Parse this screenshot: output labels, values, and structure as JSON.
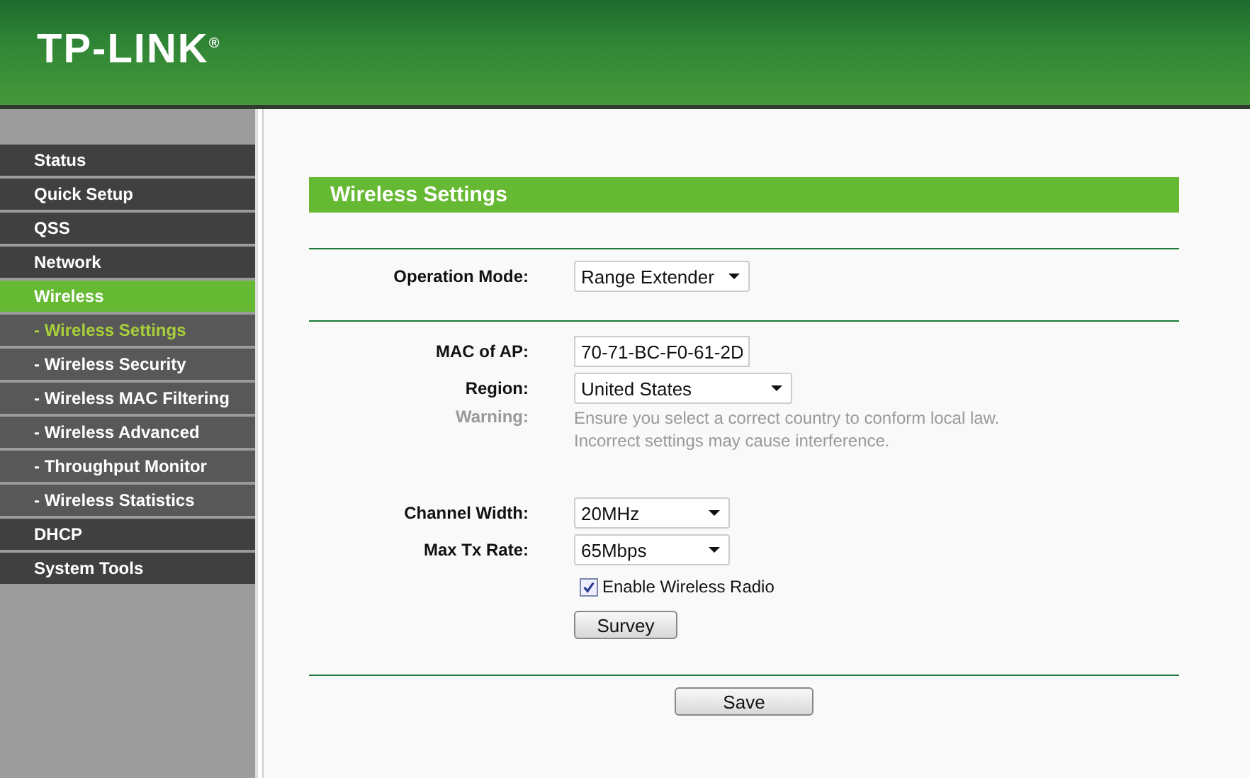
{
  "header": {
    "logo": "TP-LINK$^{®}$"
  },
  "sidebar": {
    "items": [
      {
        "label": "Status",
        "kind": "main",
        "selected": false
      },
      {
        "label": "Quick Setup",
        "kind": "main",
        "selected": false
      },
      {
        "label": "QSS",
        "kind": "main",
        "selected": false
      },
      {
        "label": "Network",
        "kind": "main",
        "selected": false
      },
      {
        "label": "Wireless",
        "kind": "main",
        "selected": true
      },
      {
        "label": "- Wireless Settings",
        "kind": "sub",
        "selected": true
      },
      {
        "label": "- Wireless Security",
        "kind": "sub",
        "selected": false
      },
      {
        "label": "- Wireless MAC Filtering",
        "kind": "sub",
        "selected": false
      },
      {
        "label": "- Wireless Advanced",
        "kind": "sub",
        "selected": false
      },
      {
        "label": "- Throughput Monitor",
        "kind": "sub",
        "selected": false
      },
      {
        "label": "- Wireless Statistics",
        "kind": "sub",
        "selected": false
      },
      {
        "label": "DHCP",
        "kind": "main",
        "selected": false
      },
      {
        "label": "System Tools",
        "kind": "main",
        "selected": false
      }
    ]
  },
  "panel": {
    "title": "Wireless Settings",
    "operation_mode": {
      "label": "Operation Mode:",
      "value": "Range Extender"
    },
    "mac_of_ap": {
      "label": "MAC of AP:",
      "value": "70-71-BC-F0-61-2D"
    },
    "region": {
      "label": "Region:",
      "value": "United States"
    },
    "warning": {
      "label": "Warning:",
      "lines": [
        "Ensure you select a correct country to conform local law.",
        "Incorrect settings may cause interference."
      ]
    },
    "channel_width": {
      "label": "Channel Width:",
      "value": "20MHz"
    },
    "max_tx_rate": {
      "label": "Max Tx Rate:",
      "value": "65Mbps"
    },
    "enable_radio": {
      "label": "Enable Wireless Radio",
      "checked": true
    },
    "survey_button": "Survey",
    "save_button": "Save"
  }
}
